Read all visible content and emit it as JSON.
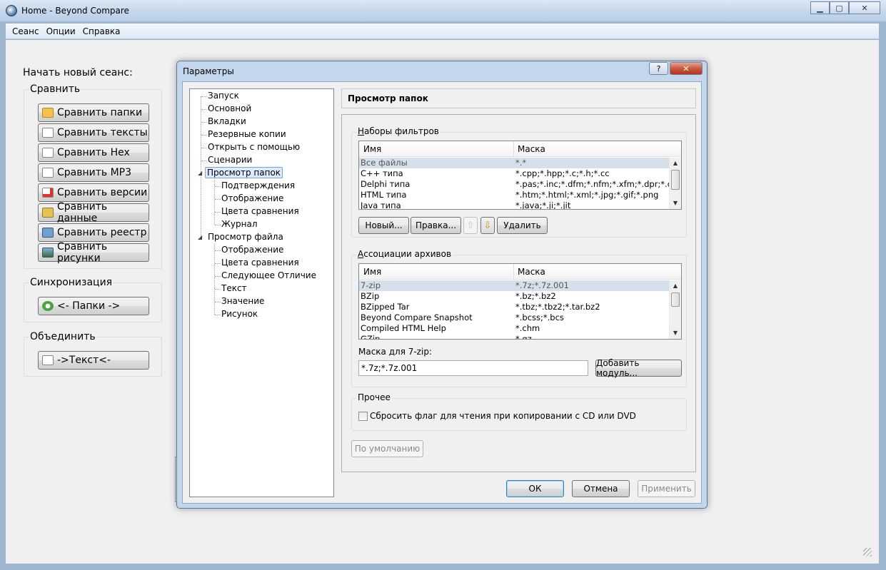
{
  "window": {
    "title": "Home - Beyond Compare",
    "controls": [
      "minimize-icon",
      "maximize-icon",
      "close-icon"
    ]
  },
  "menu": [
    "Сеанс",
    "Опции",
    "Справка"
  ],
  "session": {
    "heading": "Начать новый сеанс:",
    "compare_group": "Сравнить",
    "compare_buttons": [
      {
        "label": "Сравнить папки",
        "icon": "folder-icon"
      },
      {
        "label": "Сравнить тексты",
        "icon": "text-document-icon"
      },
      {
        "label": "Сравнить Hex",
        "icon": "hex-document-icon"
      },
      {
        "label": "Сравнить MP3",
        "icon": "mp3-document-icon"
      },
      {
        "label": "Сравнить версии",
        "icon": "version-document-icon"
      },
      {
        "label": "Сравнить данные",
        "icon": "data-icon"
      },
      {
        "label": "Сравнить реестр",
        "icon": "registry-icon"
      },
      {
        "label": "Сравнить рисунки",
        "icon": "picture-icon"
      }
    ],
    "sync_group": "Синхронизация",
    "sync_button": "<- Папки ->",
    "merge_group": "Объединить",
    "merge_button": "->Текст<-"
  },
  "dialog": {
    "title": "Параметры",
    "help_label": "?",
    "tree": [
      {
        "label": "Запуск",
        "level": 0
      },
      {
        "label": "Основной",
        "level": 0
      },
      {
        "label": "Вкладки",
        "level": 0
      },
      {
        "label": "Резервные копии",
        "level": 0
      },
      {
        "label": "Открыть с помощью",
        "level": 0
      },
      {
        "label": "Сценарии",
        "level": 0
      },
      {
        "label": "Просмотр папок",
        "level": 0,
        "selected": true,
        "expanded": true
      },
      {
        "label": "Подтверждения",
        "level": 1
      },
      {
        "label": "Отображение",
        "level": 1
      },
      {
        "label": "Цвета сравнения",
        "level": 1
      },
      {
        "label": "Журнал",
        "level": 1
      },
      {
        "label": "Просмотр файла",
        "level": 0,
        "expanded": true
      },
      {
        "label": "Отображение",
        "level": 1
      },
      {
        "label": "Цвета сравнения",
        "level": 1
      },
      {
        "label": "Следующее Отличие",
        "level": 1
      },
      {
        "label": "Текст",
        "level": 1
      },
      {
        "label": "Значение",
        "level": 1
      },
      {
        "label": "Рисунок",
        "level": 1
      }
    ],
    "page_title": "Просмотр папок",
    "filters": {
      "title_accel": "Н",
      "title_rest": "аборы фильтров",
      "col_name": "Имя",
      "col_mask": "Маска",
      "rows": [
        {
          "name": "Все файлы",
          "mask": "*.*",
          "selected": true
        },
        {
          "name": "C++ типа",
          "mask": "*.cpp;*.hpp;*.c;*.h;*.cc"
        },
        {
          "name": "Delphi типа",
          "mask": "*.pas;*.inc;*.dfm;*.nfm;*.xfm;*.dpr;*.dpk"
        },
        {
          "name": "HTML типа",
          "mask": "*.htm;*.html;*.xml;*.jpg;*.gif;*.png"
        },
        {
          "name": "Java типа",
          "mask": "*.java;*.ji;*.jit"
        }
      ],
      "btn_new": "Новый...",
      "btn_edit": "Правка...",
      "btn_delete": "Удалить"
    },
    "archives": {
      "title_accel": "А",
      "title_rest": "ссоциации архивов",
      "col_name": "Имя",
      "col_mask": "Маска",
      "rows": [
        {
          "name": "7-zip",
          "mask": "*.7z;*.7z.001",
          "selected": true
        },
        {
          "name": "BZip",
          "mask": "*.bz;*.bz2"
        },
        {
          "name": "BZipped Tar",
          "mask": "*.tbz;*.tbz2;*.tar.bz2"
        },
        {
          "name": "Beyond Compare Snapshot",
          "mask": "*.bcss;*.bcs"
        },
        {
          "name": "Compiled HTML Help",
          "mask": "*.chm"
        },
        {
          "name": "GZip",
          "mask": "*.gz"
        }
      ],
      "mask_label": "Маска для 7-zip:",
      "mask_value": "*.7z;*.7z.001",
      "btn_add_module": "Добавить модуль..."
    },
    "other": {
      "title": "Прочее",
      "checkbox_label": "Сбросить флаг для чтения при копировании с CD или DVD",
      "checked": false
    },
    "btn_defaults": "По умолчанию",
    "btn_ok": "ОК",
    "btn_cancel": "Отмена",
    "btn_apply": "Применить"
  }
}
